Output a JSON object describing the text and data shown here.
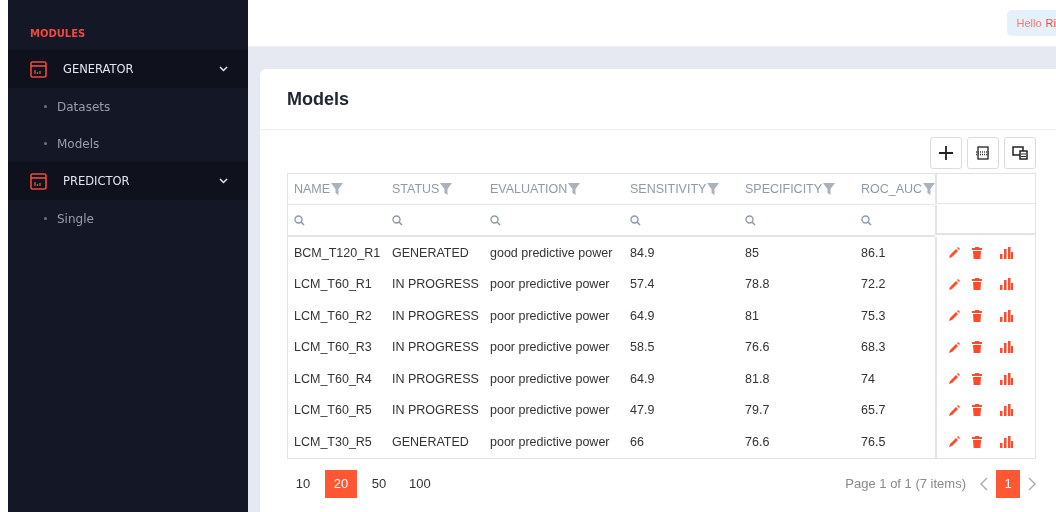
{
  "sidebar": {
    "section_title": "MODULES",
    "groups": [
      {
        "label": "GENERATOR",
        "expanded": true,
        "items": [
          {
            "label": "Datasets",
            "selected": false
          },
          {
            "label": "Models",
            "selected": false
          }
        ]
      },
      {
        "label": "PREDICTOR",
        "expanded": true,
        "items": [
          {
            "label": "Single",
            "selected": false
          }
        ]
      }
    ]
  },
  "header": {
    "greeting": "Hello",
    "user": "Ri"
  },
  "page": {
    "title": "Models"
  },
  "table": {
    "columns": [
      "NAME",
      "STATUS",
      "EVALUATION",
      "SENSITIVITY",
      "SPECIFICITY",
      "ROC_AUC"
    ],
    "rows": [
      [
        "BCM_T120_R1",
        "GENERATED",
        "good predictive power",
        "84.9",
        "85",
        "86.1"
      ],
      [
        "LCM_T60_R1",
        "IN PROGRESS",
        "poor predictive power",
        "57.4",
        "78.8",
        "72.2"
      ],
      [
        "LCM_T60_R2",
        "IN PROGRESS",
        "poor predictive power",
        "64.9",
        "81",
        "75.3"
      ],
      [
        "LCM_T60_R3",
        "IN PROGRESS",
        "poor predictive power",
        "58.5",
        "76.6",
        "68.3"
      ],
      [
        "LCM_T60_R4",
        "IN PROGRESS",
        "poor predictive power",
        "64.9",
        "81.8",
        "74"
      ],
      [
        "LCM_T60_R5",
        "IN PROGRESS",
        "poor predictive power",
        "47.9",
        "79.7",
        "65.7"
      ],
      [
        "LCM_T30_R5",
        "GENERATED",
        "poor predictive power",
        "66",
        "76.6",
        "76.5"
      ]
    ]
  },
  "pagination": {
    "page_sizes": [
      {
        "label": "10",
        "selected": false
      },
      {
        "label": "20",
        "selected": true
      },
      {
        "label": "50",
        "selected": false
      },
      {
        "label": "100",
        "selected": false
      }
    ],
    "info": "Page 1 of 1 (7 items)",
    "pages": [
      {
        "label": "1",
        "selected": true
      }
    ]
  }
}
